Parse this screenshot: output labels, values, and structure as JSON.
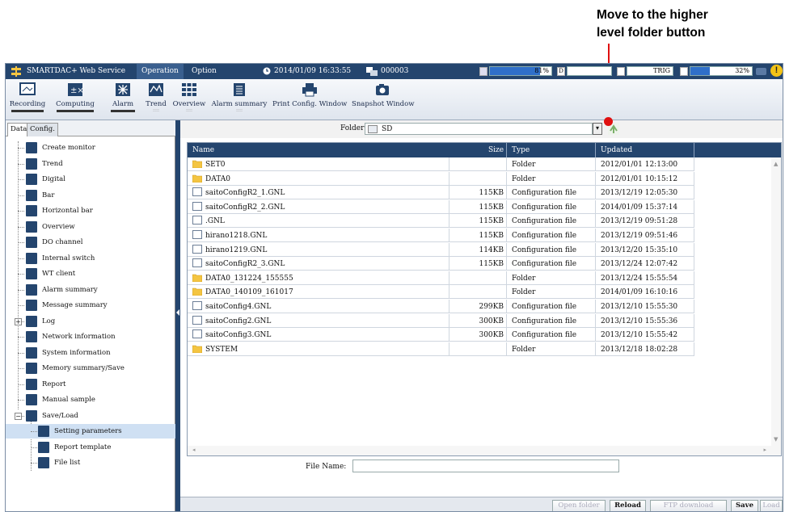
{
  "callout": {
    "text_line1": "Move to the higher",
    "text_line2": "level folder button"
  },
  "topbar": {
    "app_title": "SMARTDAC+ Web Service",
    "menu_operation": "Operation",
    "menu_option": "Option",
    "datetime": "2014/01/09 16:33:55",
    "device_id": "000003",
    "meter1_value": "81%",
    "meter1_fraction": 0.81,
    "d_icon": "D",
    "trig_label": "TRIG",
    "meter3_value": "32%",
    "meter3_fraction": 0.32,
    "alert_icon": "!"
  },
  "toolbar": {
    "recording": "Recording",
    "computing": "Computing",
    "alarm": "Alarm",
    "trend": "Trend",
    "overview": "Overview",
    "alarm_summary": "Alarm summary",
    "print_config": "Print Config. Window",
    "snapshot": "Snapshot Window"
  },
  "tabs": {
    "data": "Data",
    "config": "Config."
  },
  "tree": [
    {
      "label": "Create monitor",
      "icon": "cursor-icon"
    },
    {
      "label": "Trend",
      "icon": "trend-icon"
    },
    {
      "label": "Digital",
      "icon": "digital-icon"
    },
    {
      "label": "Bar",
      "icon": "bar-icon"
    },
    {
      "label": "Horizontal bar",
      "icon": "horizontal-bar-icon"
    },
    {
      "label": "Overview",
      "icon": "overview-icon"
    },
    {
      "label": "DO channel",
      "icon": "do-channel-icon"
    },
    {
      "label": "Internal switch",
      "icon": "internal-switch-icon"
    },
    {
      "label": "WT client",
      "icon": "wt-client-icon"
    },
    {
      "label": "Alarm summary",
      "icon": "alarm-summary-icon"
    },
    {
      "label": "Message summary",
      "icon": "message-summary-icon"
    },
    {
      "label": "Log",
      "icon": "log-icon"
    },
    {
      "label": "Network information",
      "icon": "network-icon"
    },
    {
      "label": "System information",
      "icon": "system-info-icon"
    },
    {
      "label": "Memory summary/Save",
      "icon": "memory-icon"
    },
    {
      "label": "Report",
      "icon": "report-icon"
    },
    {
      "label": "Manual sample",
      "icon": "manual-sample-icon"
    },
    {
      "label": "Save/Load",
      "icon": "save-load-icon"
    },
    {
      "label": "Setting parameters",
      "icon": "setting-params-icon"
    },
    {
      "label": "Report template",
      "icon": "report-template-icon"
    },
    {
      "label": "File list",
      "icon": "file-list-icon"
    }
  ],
  "folder": {
    "label": "Folder:",
    "value": "SD"
  },
  "table": {
    "headers": {
      "name": "Name",
      "size": "Size",
      "type": "Type",
      "updated": "Updated"
    },
    "rows": [
      {
        "name": "SET0",
        "size": "",
        "type": "Folder",
        "updated": "2012/01/01 12:13:00",
        "kind": "folder"
      },
      {
        "name": "DATA0",
        "size": "",
        "type": "Folder",
        "updated": "2012/01/01 10:15:12",
        "kind": "folder"
      },
      {
        "name": "saitoConfigR2_1.GNL",
        "size": "115KB",
        "type": "Configuration file",
        "updated": "2013/12/19 12:05:30",
        "kind": "file"
      },
      {
        "name": "saitoConfigR2_2.GNL",
        "size": "115KB",
        "type": "Configuration file",
        "updated": "2014/01/09 15:37:14",
        "kind": "file"
      },
      {
        "name": ".GNL",
        "size": "115KB",
        "type": "Configuration file",
        "updated": "2013/12/19 09:51:28",
        "kind": "file"
      },
      {
        "name": "hirano1218.GNL",
        "size": "115KB",
        "type": "Configuration file",
        "updated": "2013/12/19 09:51:46",
        "kind": "file"
      },
      {
        "name": "hirano1219.GNL",
        "size": "114KB",
        "type": "Configuration file",
        "updated": "2013/12/20 15:35:10",
        "kind": "file"
      },
      {
        "name": "saitoConfigR2_3.GNL",
        "size": "115KB",
        "type": "Configuration file",
        "updated": "2013/12/24 12:07:42",
        "kind": "file"
      },
      {
        "name": "DATA0_131224_155555",
        "size": "",
        "type": "Folder",
        "updated": "2013/12/24 15:55:54",
        "kind": "folder"
      },
      {
        "name": "DATA0_140109_161017",
        "size": "",
        "type": "Folder",
        "updated": "2014/01/09 16:10:16",
        "kind": "folder"
      },
      {
        "name": "saitoConfig4.GNL",
        "size": "299KB",
        "type": "Configuration file",
        "updated": "2013/12/10 15:55:30",
        "kind": "file"
      },
      {
        "name": "saitoConfig2.GNL",
        "size": "300KB",
        "type": "Configuration file",
        "updated": "2013/12/10 15:55:36",
        "kind": "file"
      },
      {
        "name": "saitoConfig3.GNL",
        "size": "300KB",
        "type": "Configuration file",
        "updated": "2013/12/10 15:55:42",
        "kind": "file"
      },
      {
        "name": "SYSTEM",
        "size": "",
        "type": "Folder",
        "updated": "2013/12/18 18:02:28",
        "kind": "folder"
      }
    ]
  },
  "file_name": {
    "label": "File Name:",
    "value": ""
  },
  "buttons": {
    "open_folder": "Open folder",
    "reload": "Reload",
    "ftp_download": "FTP download",
    "save": "Save",
    "load": "Load"
  },
  "colors": {
    "accent": "#24456e",
    "folder": "#f4c542",
    "callout": "#e01010"
  }
}
